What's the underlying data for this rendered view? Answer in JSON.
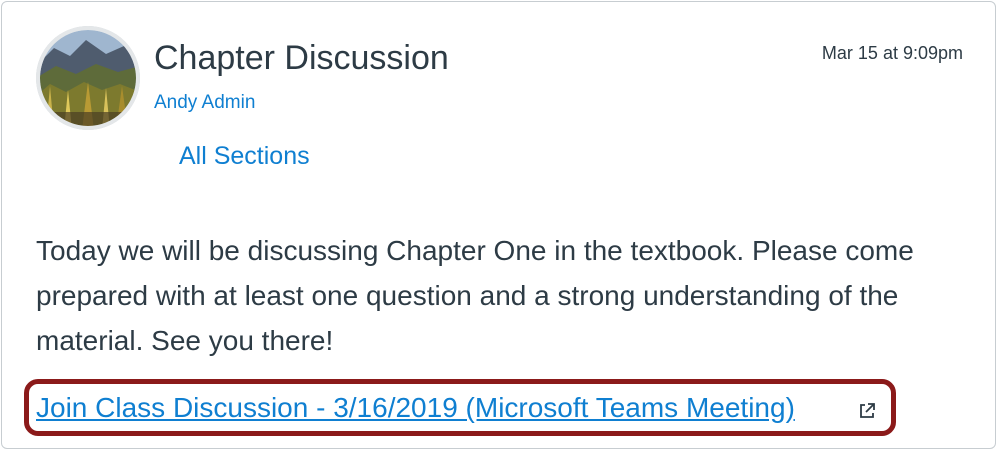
{
  "post": {
    "title": "Chapter Discussion",
    "author": "Andy Admin",
    "date": "Mar 15 at 9:09pm",
    "sections": "All Sections",
    "body": "Today we will be discussing Chapter One in the textbook. Please come prepared with at least one question and a strong understanding of the material. See you there!",
    "link_text": "Join Class Discussion - 3/16/2019 (Microsoft Teams Meeting)",
    "link_icon": "external-link-icon"
  },
  "colors": {
    "link": "#0f7fd1",
    "text": "#2d3b45",
    "highlight_border": "#8b1a1a"
  }
}
